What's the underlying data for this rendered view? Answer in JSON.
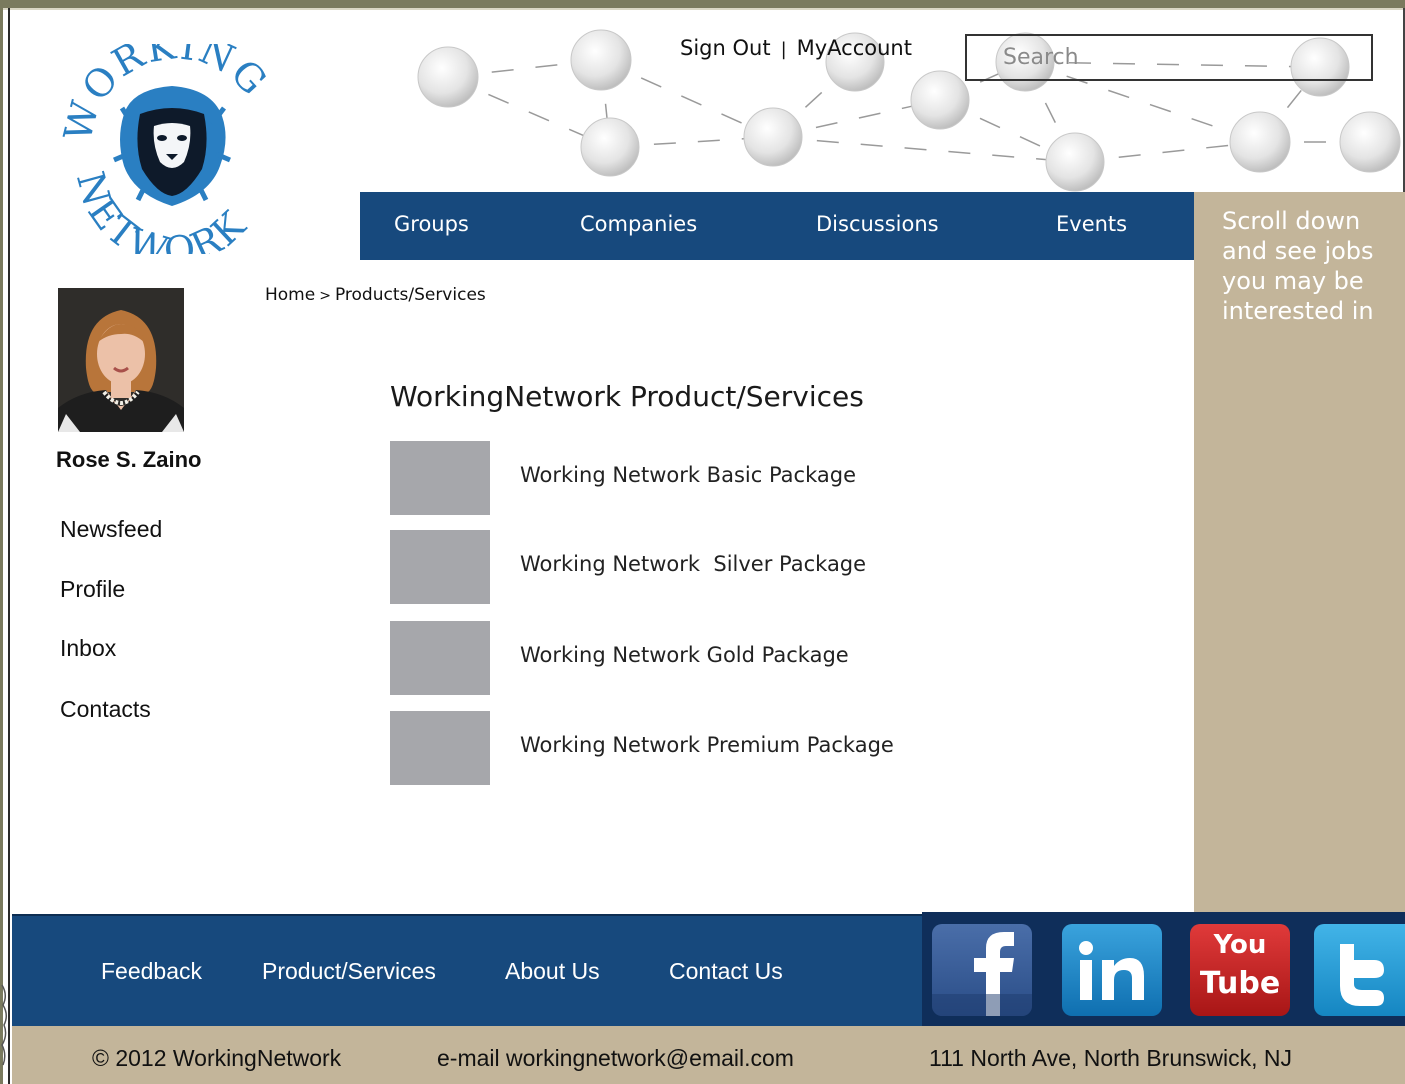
{
  "brand": {
    "logo_text_top": "WORKING",
    "logo_text_bottom": "NETWORK",
    "accent_color": "#17497d",
    "logo_color": "#2a7fc2",
    "sidebar_color": "#c3b59a",
    "logo_icon": "lion-icon"
  },
  "header": {
    "sign_out": "Sign Out",
    "separator": "|",
    "my_account": "MyAccount",
    "search_placeholder": "Search"
  },
  "nav": {
    "items": [
      "Groups",
      "Companies",
      "Discussions",
      "Events"
    ]
  },
  "sidebar_right": {
    "text": "Scroll down and see jobs you may be interested in"
  },
  "profile": {
    "name": "Rose S. Zaino",
    "links": [
      "Newsfeed",
      "Profile",
      "Inbox",
      "Contacts"
    ]
  },
  "breadcrumb": {
    "home": "Home",
    "separator": ">",
    "current": "Products/Services"
  },
  "main": {
    "title": "WorkingNetwork Product/Services",
    "products": [
      "Working Network Basic Package",
      "Working Network  Silver Package",
      "Working Network Gold Package",
      "Working Network Premium Package"
    ]
  },
  "footer": {
    "links": [
      "Feedback",
      "Product/Services",
      "About Us",
      "Contact Us"
    ],
    "social": [
      {
        "name": "facebook-icon",
        "label": "f"
      },
      {
        "name": "linkedin-icon",
        "label": "in"
      },
      {
        "name": "youtube-icon",
        "label_top": "You",
        "label_bottom": "Tube"
      },
      {
        "name": "twitter-icon",
        "label": "t"
      }
    ],
    "copyright": "© 2012 WorkingNetwork",
    "email": "e-mail workingnetwork@email.com",
    "address": "111 North Ave, North Brunswick, NJ"
  }
}
